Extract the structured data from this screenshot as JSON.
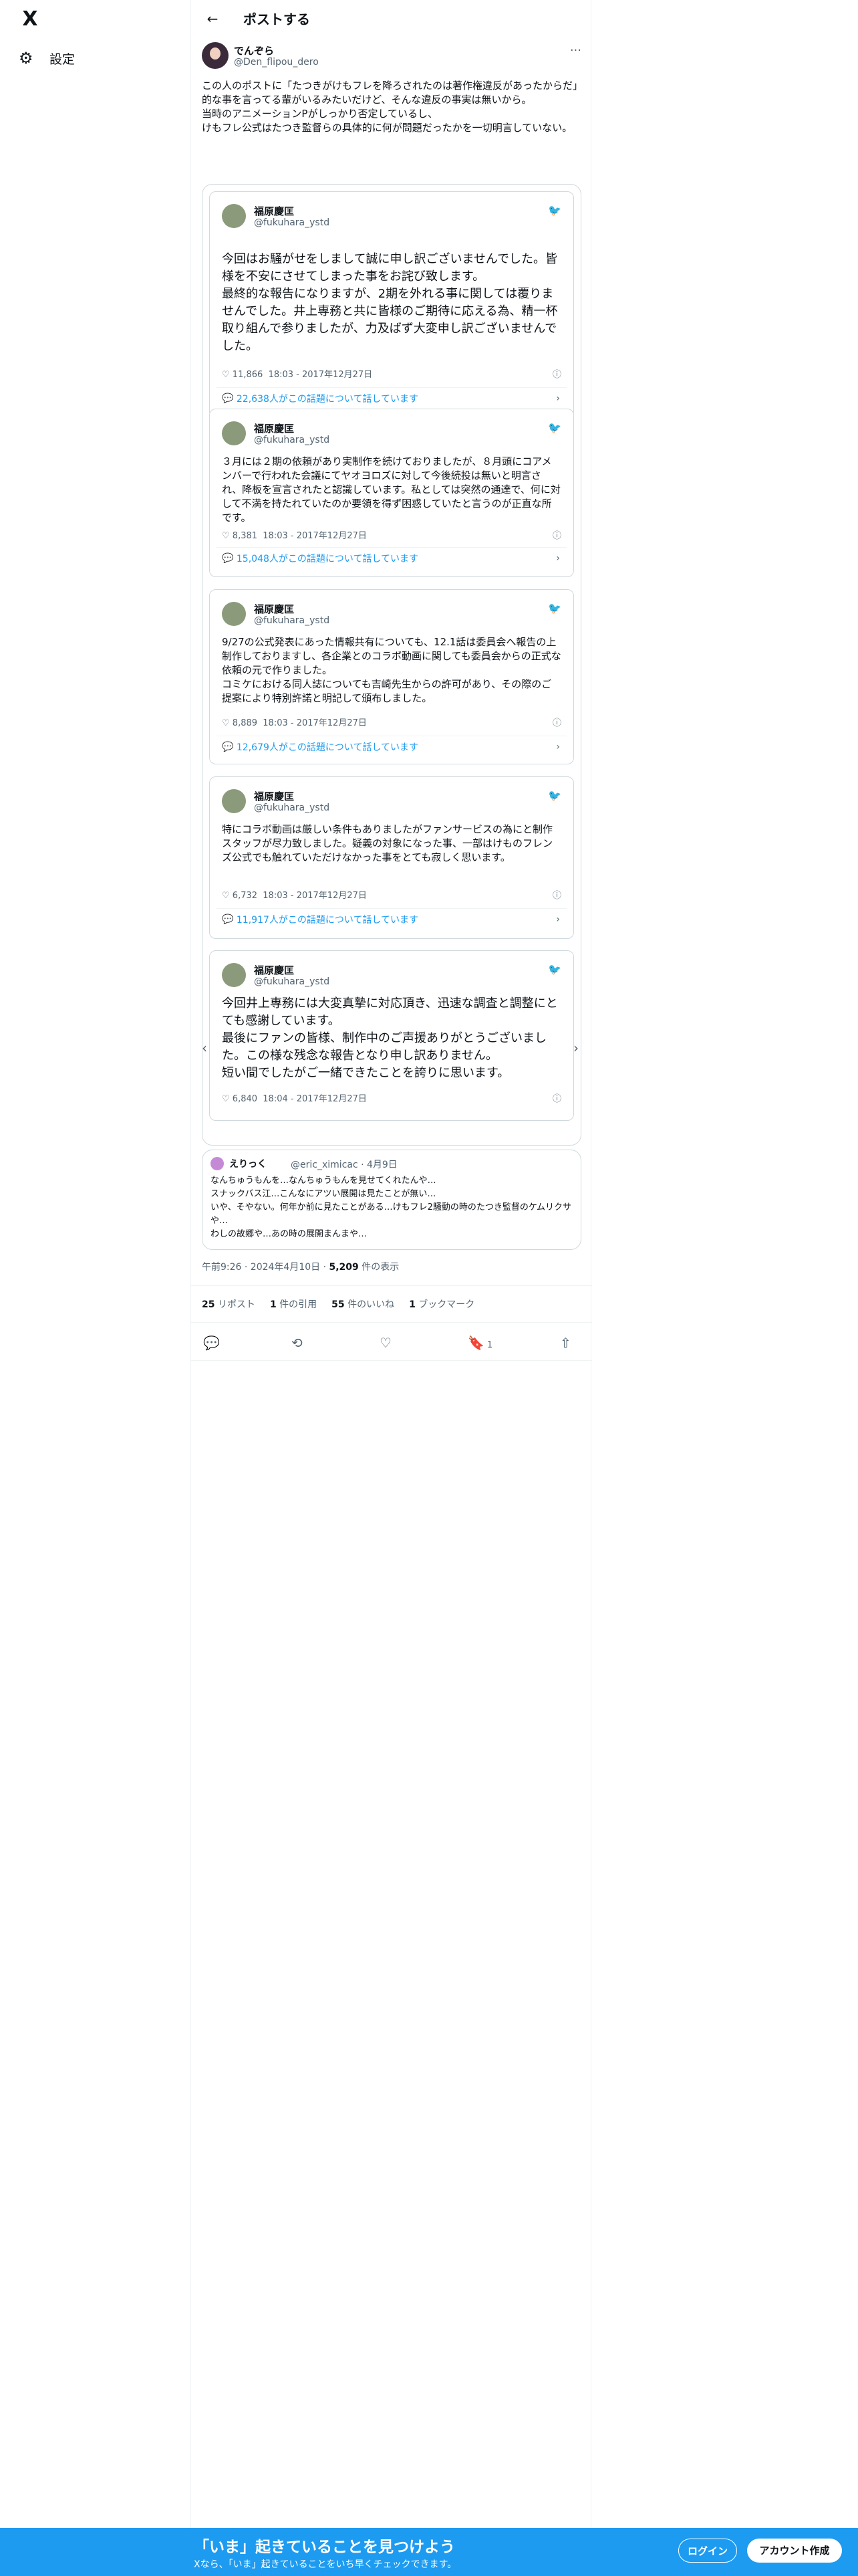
{
  "sidebar": {
    "settings_label": "設定",
    "logo_text": "X"
  },
  "header": {
    "title": "ポストする",
    "back_icon": "←"
  },
  "post": {
    "author_name": "でんぞら",
    "author_handle": "@Den_flipou_dero",
    "text": "この人のポストに「たつきがけもフレを降ろされたのは著作権違反があったからだ」\n的な事を言ってる輩がいるみたいだけど、そんな違反の事実は無いから。\n当時のアニメーションPがしっかり否定しているし、\nけもフレ公式はたつき監督らの具体的に何が問題だったかを一切明言していない。",
    "timestamp_prefix": "午前9:26 · 2024年4月10日 · ",
    "views_count": "5,209",
    "views_label": " 件の表示"
  },
  "embed": {
    "cards": [
      {
        "name": "福原慶匡",
        "handle": "@fukuhara_ystd",
        "text": "今回はお騒がせをしまして誠に申し訳ございませんでした。皆様を不安にさせてしまった事をお詫び致します。\n最終的な報告になりますが、2期を外れる事に関しては覆りませんでした。井上専務と共に皆様のご期待に応える為、精一杯取り組んで参りましたが、力及ばず大変申し訳ございませんでした。",
        "likes": "11,866",
        "time": "18:03 - 2017年12月27日",
        "talk": "22,638人がこの話題について話しています"
      },
      {
        "name": "福原慶匡",
        "handle": "@fukuhara_ystd",
        "text": "３月には２期の依頼があり実制作を続けておりましたが、８月頭にコアメンバーで行われた会議にてヤオヨロズに対して今後続投は無いと明言され、降板を宣言されたと認識しています。私としては突然の通達で、何に対して不満を持たれていたのか要領を得ず困惑していたと言うのが正直な所です。",
        "likes": "8,381",
        "time": "18:03 - 2017年12月27日",
        "talk": "15,048人がこの話題について話しています"
      },
      {
        "name": "福原慶匡",
        "handle": "@fukuhara_ystd",
        "text": "9/27の公式発表にあった情報共有についても、12.1話は委員会へ報告の上制作しておりますし、各企業とのコラボ動画に関しても委員会からの正式な依頼の元で作りました。\nコミケにおける同人誌についても吉崎先生からの許可があり、その際のご提案により特別許諾と明記して頒布しました。",
        "likes": "8,889",
        "time": "18:03 - 2017年12月27日",
        "talk": "12,679人がこの話題について話しています"
      },
      {
        "name": "福原慶匡",
        "handle": "@fukuhara_ystd",
        "text": "特にコラボ動画は厳しい条件もありましたがファンサービスの為にと制作スタッフが尽力致しました。疑義の対象になった事、一部はけものフレンズ公式でも触れていただけなかった事をとても寂しく思います。",
        "likes": "6,732",
        "time": "18:03 - 2017年12月27日",
        "talk": "11,917人がこの話題について話しています"
      },
      {
        "name": "福原慶匡",
        "handle": "@fukuhara_ystd",
        "text": "今回井上専務には大変真摯に対応頂き、迅速な調査と調整にとても感謝しています。\n最後にファンの皆様、制作中のご声援ありがとうございました。この様な残念な報告となり申し訳ありません。\n短い間でしたがご一緒できたことを誇りに思います。",
        "likes": "6,840",
        "time": "18:04 - 2017年12月27日",
        "talk": ""
      }
    ]
  },
  "quote": {
    "name": "えりっく",
    "handle": "@eric_ximicac · 4月9日",
    "text": "なんちゅうもんを…なんちゅうもんを見せてくれたんや…\nスナックバス江…こんなにアツい展開は見たことが無い…\nいや、そやない。何年か前に見たことがある…けもフレ2騒動の時のたつき監督のケムリクサや…\nわしの故郷や…あの時の展開まんまや…"
  },
  "stats": {
    "reposts_count": "25",
    "reposts_label": " リポスト",
    "quotes_count": "1",
    "quotes_label": " 件の引用",
    "likes_count": "55",
    "likes_label": " 件のいいね",
    "bookmarks_count": "1",
    "bookmarks_label": " ブックマーク"
  },
  "actions": {
    "bookmark_count": "1"
  },
  "banner": {
    "title": "「いま」起きていることを見つけよう",
    "subtitle": "Xなら、「いま」起きていることをいち早くチェックできます。",
    "login": "ログイン",
    "signup": "アカウント作成"
  },
  "colors": {
    "accent": "#1d9bf0",
    "text": "#0f1419",
    "muted": "#536471",
    "border": "#cfd9de"
  }
}
